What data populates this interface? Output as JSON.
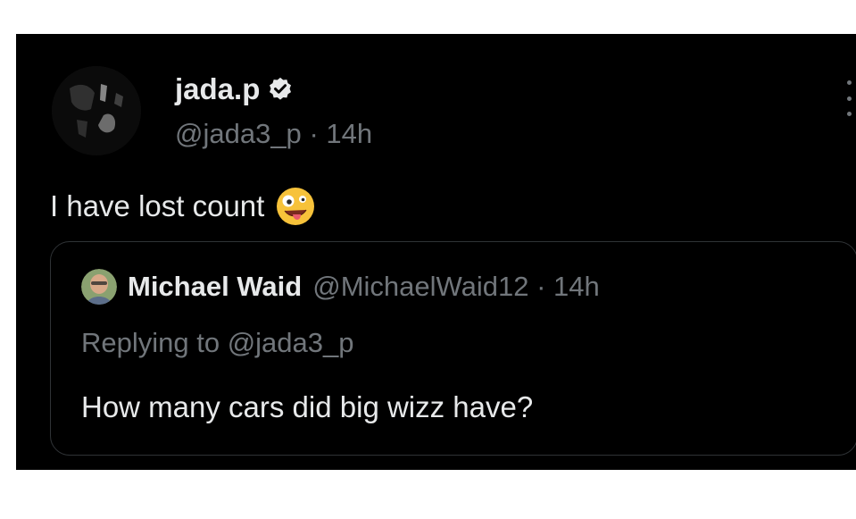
{
  "tweet": {
    "display_name": "jada.p",
    "handle": "@jada3_p",
    "separator": "·",
    "time": "14h",
    "text": "I have lost count",
    "emoji": "zany-face",
    "verified": true
  },
  "quoted_tweet": {
    "display_name": "Michael Waid",
    "handle": "@MichaelWaid12",
    "separator": "·",
    "time": "14h",
    "replying_to": "Replying to @jada3_p",
    "text": "How many cars did big wizz have?"
  },
  "colors": {
    "background": "#000000",
    "primary_text": "#e7e9ea",
    "secondary_text": "#71767b",
    "border": "#2f3336",
    "verified_badge": "#e7e9ea",
    "emoji_yellow": "#f7c23a"
  }
}
